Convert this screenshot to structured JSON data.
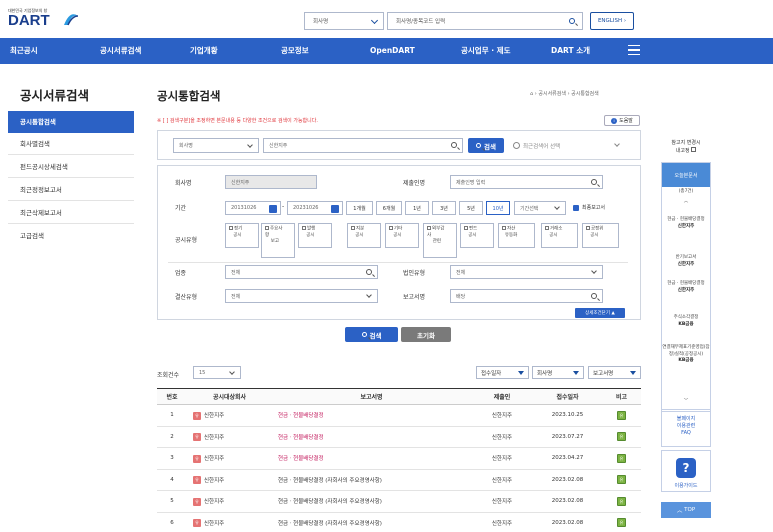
{
  "header": {
    "logo_sub": "대한민국 기업정보의 창",
    "logo_text": "DART",
    "company_select": "회사명",
    "search_placeholder": "회사명/종목코드 입력",
    "english": "ENGLISH"
  },
  "nav": {
    "items": [
      "최근공시",
      "공시서류검색",
      "기업개황",
      "공모정보",
      "OpenDART",
      "공시업무 · 제도",
      "DART 소개"
    ]
  },
  "sidebar": {
    "title": "공시서류검색",
    "items": [
      {
        "label": "공시통합검색",
        "active": true
      },
      {
        "label": "회사별검색",
        "active": false
      },
      {
        "label": "펀드공시상세검색",
        "active": false
      },
      {
        "label": "최근정정보고서",
        "active": false
      },
      {
        "label": "최근삭제보고서",
        "active": false
      },
      {
        "label": "고급검색",
        "active": false
      }
    ]
  },
  "main": {
    "title": "공시통합검색",
    "breadcrumb": "공시서류검색 › 공시통합검색",
    "notice": "※ [ ] 검색구분]을 조정하면 본문내용 등 다양한 조건으로 검색이 가능합니다.",
    "help": "도움말",
    "search": {
      "type": "회사명",
      "keyword": "신한지주",
      "button": "검색",
      "recent_placeholder": "최근검색어 선택"
    },
    "detail": {
      "company_label": "회사명",
      "company_value": "신한지주",
      "submitter_label": "제출인명",
      "submitter_placeholder": "제출인명 입력",
      "period_label": "기간",
      "date_from": "20131026",
      "date_sep": "-",
      "date_to": "20231026",
      "periods": [
        "1개월",
        "6개월",
        "1년",
        "3년",
        "5년",
        "10년"
      ],
      "period_active": "10년",
      "period_select": "기간선택",
      "final_report": "최종보고서",
      "type_label": "공시유형",
      "types": [
        {
          "l1": "정기",
          "l2": "공시"
        },
        {
          "l1": "주요사",
          "l2": "항",
          "l3": "보고"
        },
        {
          "l1": "발행",
          "l2": "공시"
        },
        {
          "l1": "지분",
          "l2": "공시"
        },
        {
          "l1": "기타",
          "l2": "공시"
        },
        {
          "l1": "외부감",
          "l2": "사",
          "l3": "관련"
        },
        {
          "l1": "펀드",
          "l2": "공시"
        },
        {
          "l1": "자산",
          "l2": "유동화"
        },
        {
          "l1": "거래소",
          "l2": "공시"
        },
        {
          "l1": "공정위",
          "l2": "공시"
        }
      ],
      "industry_label": "업종",
      "industry_value": "전체",
      "corp_type_label": "법인유형",
      "corp_type_value": "전체",
      "settle_label": "결산유형",
      "settle_value": "전체",
      "report_label": "보고서명",
      "report_value": "배당",
      "toggle": "상세조건닫기 ▲"
    },
    "buttons": {
      "search": "검색",
      "reset": "초기화"
    }
  },
  "results": {
    "count_label": "조회건수",
    "page_size": "15",
    "sort1": "접수일자",
    "sort2": "회사명",
    "sort3": "보고서명",
    "columns": [
      "번호",
      "공시대상회사",
      "보고서명",
      "제출인",
      "접수일자",
      "비고"
    ],
    "badge": "유",
    "bigo": "유",
    "rows": [
      {
        "no": "1",
        "company": "신한지주",
        "report": "현금ㆍ현물배당결정",
        "submitter": "신한지주",
        "date": "2023.10.25",
        "pink": true
      },
      {
        "no": "2",
        "company": "신한지주",
        "report": "현금ㆍ현물배당결정",
        "submitter": "신한지주",
        "date": "2023.07.27",
        "pink": true
      },
      {
        "no": "3",
        "company": "신한지주",
        "report": "현금ㆍ현물배당결정",
        "submitter": "신한지주",
        "date": "2023.04.27",
        "pink": true
      },
      {
        "no": "4",
        "company": "신한지주",
        "report": "현금ㆍ현물배당결정 (자회사의 주요경영사항)",
        "submitter": "신한지주",
        "date": "2023.02.08",
        "pink": false
      },
      {
        "no": "5",
        "company": "신한지주",
        "report": "현금ㆍ현물배당결정 (자회사의 주요경영사항)",
        "submitter": "신한지주",
        "date": "2023.02.08",
        "pink": false
      },
      {
        "no": "6",
        "company": "신한지주",
        "report": "현금ㆍ현물배당결정 (자회사의 주요경영사항)",
        "submitter": "신한지주",
        "date": "2023.02.08",
        "pink": false
      }
    ]
  },
  "quick": {
    "viewed_l1": "참고지 변경시",
    "viewed_l2": "내고정",
    "head": "오늘본문서",
    "count": "(총7건)",
    "items": [
      {
        "t": "현금 · 현물배당결정",
        "c": "신한지주"
      },
      {
        "t": "반기보고서",
        "c": "신한지주"
      },
      {
        "t": "현금 · 현물배당결정",
        "c": "신한지주"
      },
      {
        "t": "주식소각결정",
        "c": "KB금융"
      },
      {
        "t": "연결재무제표기준영업(잠정)실적(공정공시)",
        "c": "KB금융"
      }
    ],
    "box1_l1": "볼페이지",
    "box1_l2": "이용관련",
    "box1_l3": "FAQ",
    "box2": "이용가이드",
    "top": "TOP"
  }
}
